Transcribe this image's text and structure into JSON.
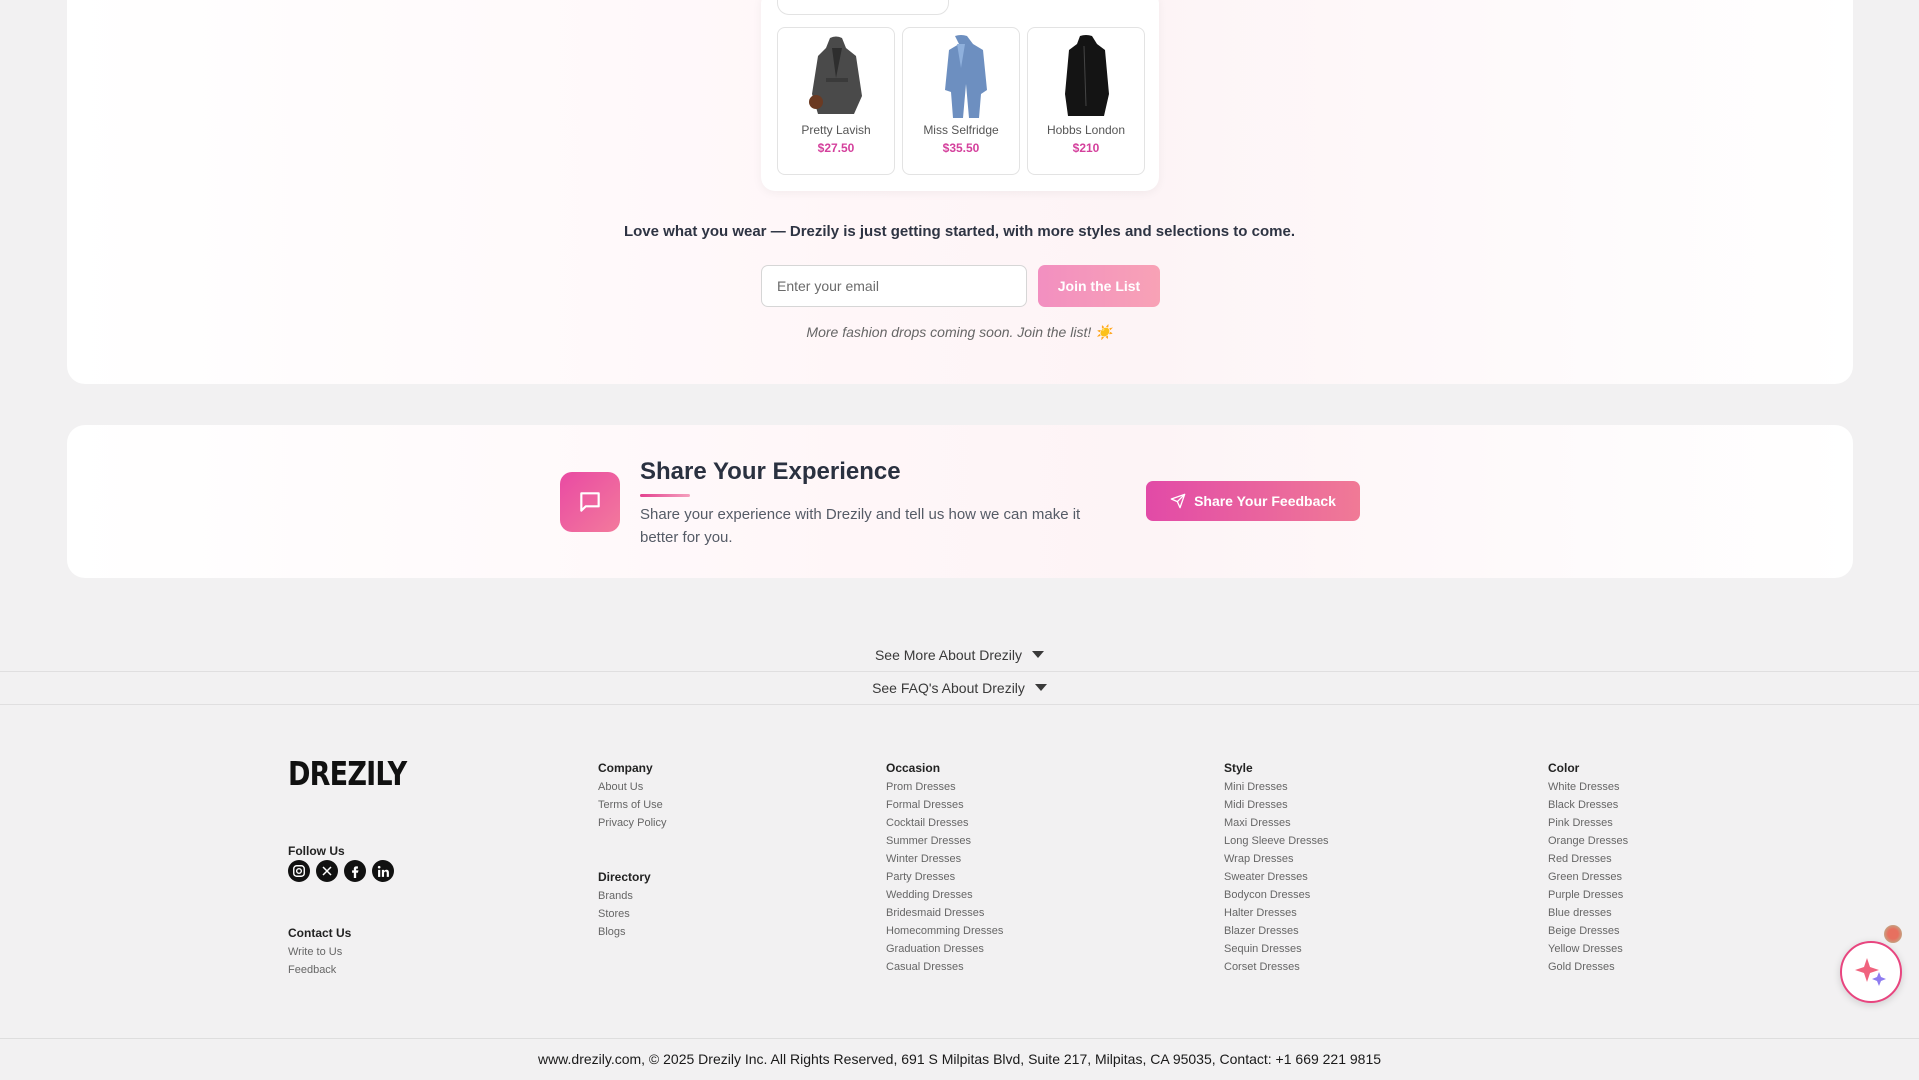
{
  "products": [
    {
      "brand": "Pretty Lavish",
      "price": "$27.50"
    },
    {
      "brand": "Miss Selfridge",
      "price": "$35.50"
    },
    {
      "brand": "Hobbs London",
      "price": "$210"
    }
  ],
  "newsletter": {
    "tagline": "Love what you wear — Drezily is just getting started, with more styles and selections to come.",
    "email_placeholder": "Enter your email",
    "join_label": "Join the List",
    "note": "More fashion drops coming soon. Join the list! ☀️"
  },
  "experience": {
    "title": "Share Your Experience",
    "description": "Share your experience with Drezily and tell us how we can make it better for you.",
    "button_label": "Share Your Feedback"
  },
  "accordions": {
    "more": "See More About Drezily",
    "faq": "See FAQ's About Drezily"
  },
  "footer": {
    "logo": "DREZILY",
    "follow_us": "Follow Us",
    "contact_heading": "Contact Us",
    "contact": [
      "Write to Us",
      "Feedback"
    ],
    "company_heading": "Company",
    "company": [
      "About Us",
      "Terms of Use",
      "Privacy Policy"
    ],
    "directory_heading": "Directory",
    "directory": [
      "Brands",
      "Stores",
      "Blogs"
    ],
    "occasion_heading": "Occasion",
    "occasion": [
      "Prom Dresses",
      "Formal Dresses",
      "Cocktail Dresses",
      "Summer Dresses",
      "Winter Dresses",
      "Party Dresses",
      "Wedding Dresses",
      "Bridesmaid Dresses",
      "Homecomming Dresses",
      "Graduation Dresses",
      "Casual Dresses"
    ],
    "style_heading": "Style",
    "style": [
      "Mini Dresses",
      "Midi Dresses",
      "Maxi Dresses",
      "Long Sleeve Dresses",
      "Wrap Dresses",
      "Sweater Dresses",
      "Bodycon Dresses",
      "Halter Dresses",
      "Blazer Dresses",
      "Sequin Dresses",
      "Corset Dresses"
    ],
    "color_heading": "Color",
    "color": [
      "White Dresses",
      "Black Dresses",
      "Pink Dresses",
      "Orange Dresses",
      "Red Dresses",
      "Green Dresses",
      "Purple Dresses",
      "Blue dresses",
      "Beige Dresses",
      "Yellow Dresses",
      "Gold Dresses"
    ],
    "copyright": "www.drezily.com, © 2025 Drezily Inc. All Rights Reserved, 691 S Milpitas Blvd, Suite 217, Milpitas, CA 95035, Contact: +1 669 221 9815"
  },
  "icons": {
    "social": [
      "instagram-icon",
      "x-icon",
      "facebook-icon",
      "linkedin-icon"
    ],
    "experience": "chat-icon",
    "feedback": "send-icon",
    "assistant": "sparkle-icon"
  },
  "colors": {
    "accent_pink": "#e24aa7",
    "price_pink": "#d4409c"
  }
}
